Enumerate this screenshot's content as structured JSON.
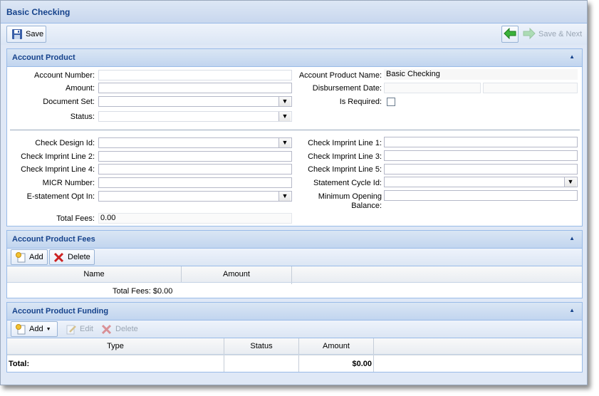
{
  "window": {
    "title": "Basic Checking"
  },
  "toolbar": {
    "save_label": "Save",
    "save_next_label": "Save & Next"
  },
  "account_product": {
    "title": "Account Product",
    "labels": {
      "account_number": "Account Number:",
      "amount": "Amount:",
      "document_set": "Document Set:",
      "status": "Status:",
      "account_product_name": "Account Product Name:",
      "disbursement_date": "Disbursement Date:",
      "is_required": "Is Required:",
      "check_design_id": "Check Design Id:",
      "check_imprint_line_2": "Check Imprint Line 2:",
      "check_imprint_line_4": "Check Imprint Line 4:",
      "micr_number": "MICR Number:",
      "estatement_opt_in": "E-statement Opt In:",
      "total_fees": "Total Fees:",
      "check_imprint_line_1": "Check Imprint Line 1:",
      "check_imprint_line_3": "Check Imprint Line 3:",
      "check_imprint_line_5": "Check Imprint Line 5:",
      "statement_cycle_id": "Statement Cycle Id:",
      "minimum_opening_balance": "Minimum Opening Balance:"
    },
    "values": {
      "account_number": "",
      "amount": "",
      "document_set": "",
      "status": "",
      "account_product_name": "Basic Checking",
      "disbursement_date": "",
      "disbursement_time": "",
      "check_design_id": "",
      "check_imprint_line_1": "",
      "check_imprint_line_2": "",
      "check_imprint_line_3": "",
      "check_imprint_line_4": "",
      "check_imprint_line_5": "",
      "micr_number": "",
      "statement_cycle_id": "",
      "estatement_opt_in": "",
      "minimum_opening_balance": "",
      "total_fees": "0.00",
      "is_required": false
    }
  },
  "fees": {
    "title": "Account Product Fees",
    "add_label": "Add",
    "delete_label": "Delete",
    "columns": [
      "Name",
      "Amount"
    ],
    "rows": [],
    "summary": "Total Fees: $0.00"
  },
  "funding": {
    "title": "Account Product Funding",
    "add_label": "Add",
    "edit_label": "Edit",
    "delete_label": "Delete",
    "columns": [
      "Type",
      "Status",
      "Amount"
    ],
    "rows": [],
    "total_label": "Total:",
    "total_amount": "$0.00"
  },
  "icons": {
    "save": "floppy-disk-icon",
    "back": "green-back-arrow-icon",
    "next": "green-next-arrow-icon",
    "add": "add-document-icon",
    "delete": "red-x-icon",
    "edit": "edit-pencil-icon",
    "dropdown": "chevron-down-icon"
  },
  "colors": {
    "header_text": "#15428b",
    "panel_border": "#99bbe8",
    "accent_green": "#2e9a2e",
    "delete_red": "#cc2222"
  }
}
